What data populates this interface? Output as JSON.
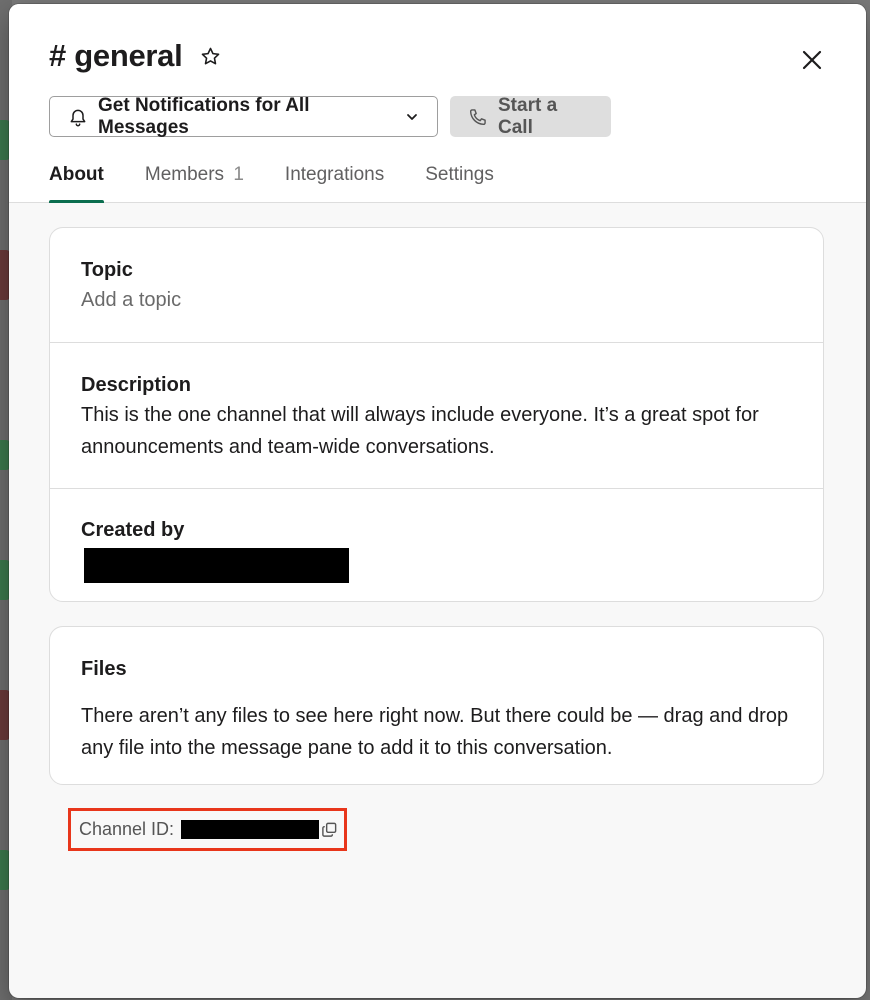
{
  "channel": {
    "title": "# general",
    "star_icon": "star-icon",
    "close_icon": "close-icon"
  },
  "actions": {
    "notifications_label": "Get Notifications for All Messages",
    "notifications_icon": "bell-icon",
    "dropdown_icon": "chevron-down-icon",
    "call_label": "Start a Call",
    "call_icon": "phone-icon"
  },
  "tabs": [
    {
      "label": "About",
      "count": "",
      "active": true
    },
    {
      "label": "Members",
      "count": "1",
      "active": false
    },
    {
      "label": "Integrations",
      "count": "",
      "active": false
    },
    {
      "label": "Settings",
      "count": "",
      "active": false
    }
  ],
  "about": {
    "topic_label": "Topic",
    "topic_value": "Add a topic",
    "description_label": "Description",
    "description_value": "This is the one channel that will always include everyone. It’s a great spot for announcements and team-wide conversations.",
    "created_by_label": "Created by"
  },
  "files": {
    "label": "Files",
    "empty_text": "There aren’t any files to see here right now. But there could be — drag and drop any file into the message pane to add it to this conversation."
  },
  "channel_id": {
    "label": "Channel ID:",
    "copy_icon": "copy-icon"
  },
  "colors": {
    "accent": "#0b6e4f",
    "highlight_border": "#e8361b"
  }
}
